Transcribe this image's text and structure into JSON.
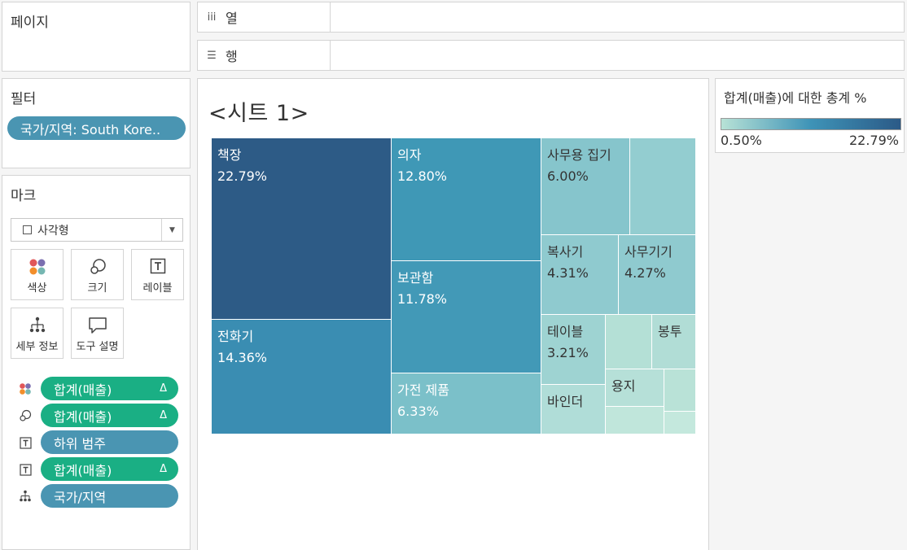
{
  "pages": {
    "title": "페이지"
  },
  "columns_shelf": {
    "icon": "iii",
    "label": "열"
  },
  "rows_shelf": {
    "icon": "☰",
    "label": "행"
  },
  "filters": {
    "title": "필터",
    "items": [
      {
        "label": "국가/지역: South Kore.."
      }
    ]
  },
  "marks": {
    "title": "마크",
    "mark_type": "사각형",
    "buttons": [
      {
        "id": "color",
        "label": "색상",
        "icon": "color-icon"
      },
      {
        "id": "size",
        "label": "크기",
        "icon": "size-icon"
      },
      {
        "id": "label",
        "label": "레이블",
        "icon": "label-icon"
      },
      {
        "id": "detail",
        "label": "세부 정보",
        "icon": "detail-icon"
      },
      {
        "id": "tooltip",
        "label": "도구 설명",
        "icon": "tooltip-icon"
      }
    ],
    "fields": [
      {
        "icon": "color-icon",
        "label": "합계(매출)",
        "delta": "Δ",
        "color": "green"
      },
      {
        "icon": "size-icon",
        "label": "합계(매출)",
        "delta": "Δ",
        "color": "green"
      },
      {
        "icon": "label-icon",
        "label": "하위 범주",
        "delta": "",
        "color": "blue"
      },
      {
        "icon": "label-icon",
        "label": "합계(매출)",
        "delta": "Δ",
        "color": "green"
      },
      {
        "icon": "detail-icon",
        "label": "국가/지역",
        "delta": "",
        "color": "blue"
      }
    ]
  },
  "sheet": {
    "title": "<시트 1>"
  },
  "legend": {
    "title": "합계(매출)에 대한 총계 %",
    "min": "0.50%",
    "max": "22.79%",
    "colors": [
      "#b8e2d6",
      "#3e93b7",
      "#2b5a87"
    ]
  },
  "chart_data": {
    "type": "treemap",
    "title": "<시트 1>",
    "items": [
      {
        "category": "책장",
        "percent": "22.79%",
        "value": 22.79
      },
      {
        "category": "전화기",
        "percent": "14.36%",
        "value": 14.36
      },
      {
        "category": "의자",
        "percent": "12.80%",
        "value": 12.8
      },
      {
        "category": "보관함",
        "percent": "11.78%",
        "value": 11.78
      },
      {
        "category": "가전 제품",
        "percent": "6.33%",
        "value": 6.33
      },
      {
        "category": "사무용 집기",
        "percent": "6.00%",
        "value": 6.0
      },
      {
        "category": "복사기",
        "percent": "4.31%",
        "value": 4.31
      },
      {
        "category": "사무기기",
        "percent": "4.27%",
        "value": 4.27
      },
      {
        "category": "테이블",
        "percent": "3.21%",
        "value": 3.21
      },
      {
        "category": "바인더",
        "percent": "",
        "value": null
      },
      {
        "category": "용지",
        "percent": "",
        "value": null
      },
      {
        "category": "봉투",
        "percent": "",
        "value": null
      }
    ]
  }
}
